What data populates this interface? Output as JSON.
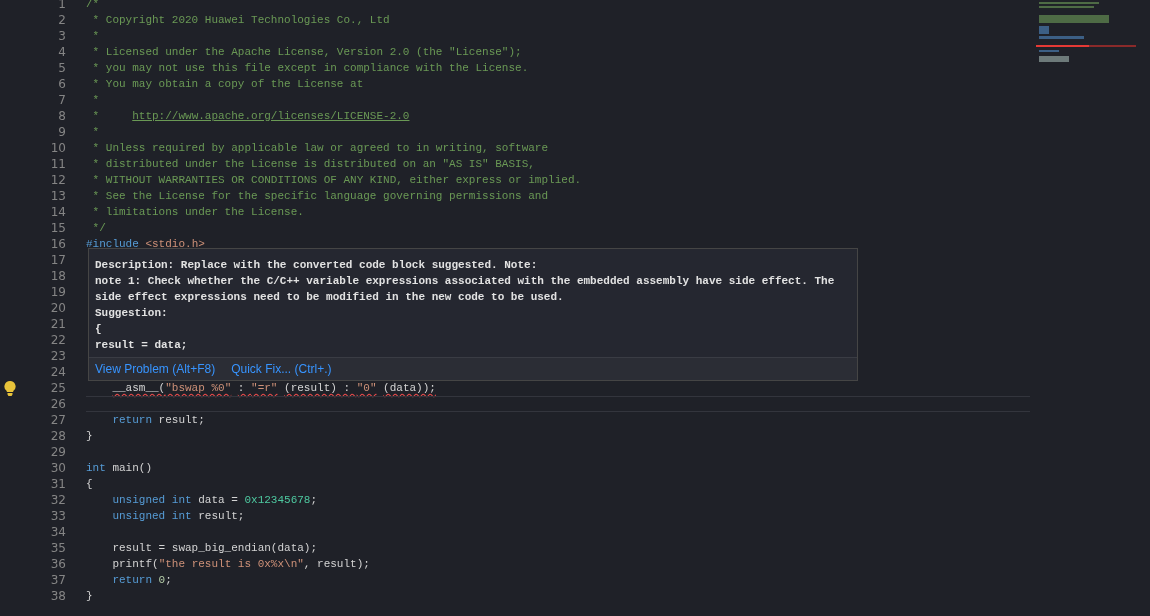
{
  "editor": {
    "lines": [
      {
        "number": "1",
        "tokens": [
          {
            "kind": "comment",
            "text": "/*"
          }
        ]
      },
      {
        "number": "2",
        "tokens": [
          {
            "kind": "comment",
            "text": " * Copyright 2020 Huawei Technologies Co., Ltd"
          }
        ]
      },
      {
        "number": "3",
        "tokens": [
          {
            "kind": "comment",
            "text": " *"
          }
        ]
      },
      {
        "number": "4",
        "tokens": [
          {
            "kind": "comment",
            "text": " * Licensed under the Apache License, Version 2.0 (the \"License\");"
          }
        ]
      },
      {
        "number": "5",
        "tokens": [
          {
            "kind": "comment",
            "text": " * you may not use this file except in compliance with the License."
          }
        ]
      },
      {
        "number": "6",
        "tokens": [
          {
            "kind": "comment",
            "text": " * You may obtain a copy of the License at"
          }
        ]
      },
      {
        "number": "7",
        "tokens": [
          {
            "kind": "comment",
            "text": " *"
          }
        ]
      },
      {
        "number": "8",
        "tokens": [
          {
            "kind": "comment",
            "text": " *     "
          },
          {
            "kind": "link",
            "text": "http://www.apache.org/licenses/LICENSE-2.0"
          }
        ]
      },
      {
        "number": "9",
        "tokens": [
          {
            "kind": "comment",
            "text": " *"
          }
        ]
      },
      {
        "number": "10",
        "tokens": [
          {
            "kind": "comment",
            "text": " * Unless required by applicable law or agreed to in writing, software"
          }
        ]
      },
      {
        "number": "11",
        "tokens": [
          {
            "kind": "comment",
            "text": " * distributed under the License is distributed on an \"AS IS\" BASIS,"
          }
        ]
      },
      {
        "number": "12",
        "tokens": [
          {
            "kind": "comment",
            "text": " * WITHOUT WARRANTIES OR CONDITIONS OF ANY KIND, either express or implied."
          }
        ]
      },
      {
        "number": "13",
        "tokens": [
          {
            "kind": "comment",
            "text": " * See the License for the specific language governing permissions and"
          }
        ]
      },
      {
        "number": "14",
        "tokens": [
          {
            "kind": "comment",
            "text": " * limitations under the License."
          }
        ]
      },
      {
        "number": "15",
        "tokens": [
          {
            "kind": "comment",
            "text": " */"
          }
        ]
      },
      {
        "number": "16",
        "tokens": [
          {
            "kind": "preproc",
            "text": "#include "
          },
          {
            "kind": "string",
            "text": "<stdio.h>"
          }
        ]
      },
      {
        "number": "17"
      },
      {
        "number": "18"
      },
      {
        "number": "19"
      },
      {
        "number": "20"
      },
      {
        "number": "21"
      },
      {
        "number": "22"
      },
      {
        "number": "23"
      },
      {
        "number": "24"
      },
      {
        "number": "25",
        "error": true,
        "lightbulb": true,
        "tokens": [
          {
            "kind": "plain",
            "text": "    __asm__("
          },
          {
            "kind": "string",
            "text": "\"bswap %0\""
          },
          {
            "kind": "plain",
            "text": " : "
          },
          {
            "kind": "string",
            "text": "\"=r\""
          },
          {
            "kind": "plain",
            "text": " (result) : "
          },
          {
            "kind": "string",
            "text": "\"0\""
          },
          {
            "kind": "plain",
            "text": " (data));"
          }
        ]
      },
      {
        "number": "26",
        "current": true
      },
      {
        "number": "27",
        "tokens": [
          {
            "kind": "keyword",
            "text": "    return"
          },
          {
            "kind": "plain",
            "text": " result;"
          }
        ]
      },
      {
        "number": "28",
        "tokens": [
          {
            "kind": "plain",
            "text": "}"
          }
        ]
      },
      {
        "number": "29"
      },
      {
        "number": "30",
        "tokens": [
          {
            "kind": "keyword",
            "text": "int"
          },
          {
            "kind": "plain",
            "text": " main()"
          }
        ]
      },
      {
        "number": "31",
        "tokens": [
          {
            "kind": "plain",
            "text": "{"
          }
        ]
      },
      {
        "number": "32",
        "tokens": [
          {
            "kind": "keyword",
            "text": "    unsigned int"
          },
          {
            "kind": "plain",
            "text": " data = "
          },
          {
            "kind": "hexnumber",
            "text": "0x12345678"
          },
          {
            "kind": "plain",
            "text": ";"
          }
        ]
      },
      {
        "number": "33",
        "tokens": [
          {
            "kind": "keyword",
            "text": "    unsigned int"
          },
          {
            "kind": "plain",
            "text": " result;"
          }
        ]
      },
      {
        "number": "34"
      },
      {
        "number": "35",
        "tokens": [
          {
            "kind": "plain",
            "text": "    result = swap_big_endian(data);"
          }
        ]
      },
      {
        "number": "36",
        "tokens": [
          {
            "kind": "plain",
            "text": "    printf("
          },
          {
            "kind": "string",
            "text": "\"the result is 0x%x\\n\""
          },
          {
            "kind": "plain",
            "text": ", result);"
          }
        ]
      },
      {
        "number": "37",
        "tokens": [
          {
            "kind": "keyword",
            "text": "    return"
          },
          {
            "kind": "number",
            "text": " 0"
          },
          {
            "kind": "plain",
            "text": ";"
          }
        ]
      },
      {
        "number": "38",
        "tokens": [
          {
            "kind": "plain",
            "text": "}"
          }
        ]
      }
    ]
  },
  "hover": {
    "lines": [
      "Description: Replace with the converted code block suggested. Note:",
      "note 1: Check whether the C/C++ variable expressions associated with the embedded assembly have side effect. The",
      "side effect expressions need to be modified in the new code to be used.",
      "Suggestion:",
      "{",
      "result = data;"
    ],
    "actions": [
      "View Problem (Alt+F8)",
      "Quick Fix... (Ctrl+.)"
    ]
  }
}
